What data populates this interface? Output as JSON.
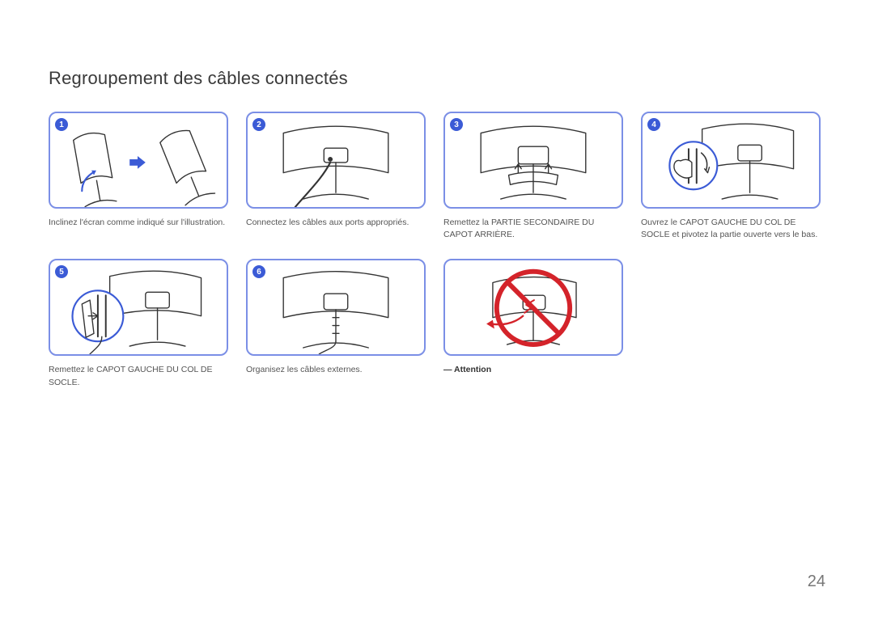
{
  "title": "Regroupement des câbles connectés",
  "page_number": "24",
  "steps": [
    {
      "num": "1",
      "caption": "Inclinez l'écran comme indiqué sur l'illustration."
    },
    {
      "num": "2",
      "caption": "Connectez les câbles aux ports appropriés."
    },
    {
      "num": "3",
      "caption": "Remettez la PARTIE SECONDAIRE DU CAPOT ARRIÈRE."
    },
    {
      "num": "4",
      "caption": "Ouvrez le CAPOT GAUCHE DU COL DE SOCLE et pivotez la partie ouverte vers le bas."
    },
    {
      "num": "5",
      "caption": "Remettez le CAPOT GAUCHE DU COL DE SOCLE."
    },
    {
      "num": "6",
      "caption": "Organisez les câbles externes."
    }
  ],
  "warning_caption_prefix": "― ",
  "warning_caption": "Attention"
}
